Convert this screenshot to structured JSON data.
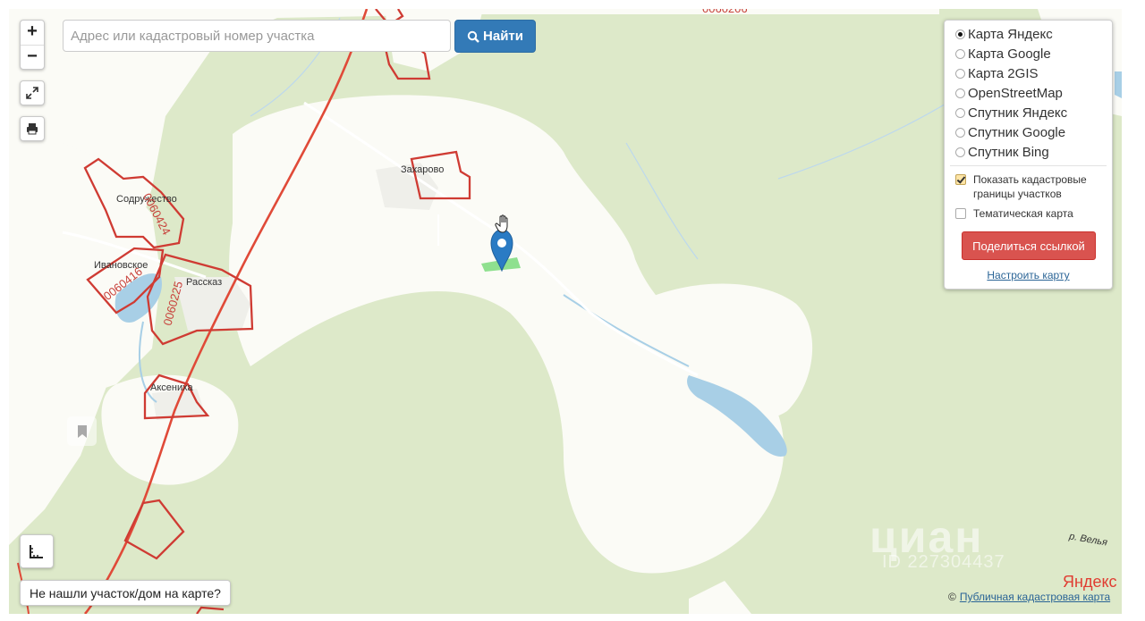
{
  "search": {
    "placeholder": "Адрес или кадастровый номер участка",
    "button_label": "Найти"
  },
  "zoom": {
    "in_label": "+",
    "out_label": "−"
  },
  "map_layers": {
    "options": [
      {
        "label": "Карта Яндекс",
        "selected": true
      },
      {
        "label": "Карта Google",
        "selected": false
      },
      {
        "label": "Карта 2GIS",
        "selected": false
      },
      {
        "label": "OpenStreetMap",
        "selected": false
      },
      {
        "label": "Спутник Яндекс",
        "selected": false
      },
      {
        "label": "Спутник Google",
        "selected": false
      },
      {
        "label": "Спутник Bing",
        "selected": false
      }
    ],
    "show_cadastral_label": "Показать кадастровые границы участков",
    "show_cadastral_checked": true,
    "thematic_label": "Тематическая карта",
    "thematic_checked": false,
    "share_label": "Поделиться ссылкой",
    "configure_label": "Настроить карту"
  },
  "not_found_label": "Не нашли участок/дом на карте?",
  "places": {
    "zakharovo": "Захарово",
    "sodruzhestvo": "Содружество",
    "ivanovskoe": "Ивановское",
    "rasskoe": "Рассказ",
    "akseniha": "Аксениха",
    "river": "р. Велья"
  },
  "parcels": {
    "p1": "0060424",
    "p2": "0060416",
    "p3": "0060225",
    "top": "0060206"
  },
  "watermark": {
    "brand": "циан",
    "id": "ID 227304437"
  },
  "yandex_logo": "Яндекс",
  "copyright": {
    "prefix": "©",
    "link": "Публичная кадастровая карта"
  },
  "colors": {
    "forest": "#dde9c9",
    "field": "#fbfbf6",
    "water": "#a8cfe6",
    "road": "#e04a38",
    "parcel_border": "#cf3b33",
    "marker": "#2a7bc4",
    "selected_parcel": "#8fe08f",
    "find_button": "#337ab7",
    "share_button": "#d9534f"
  }
}
